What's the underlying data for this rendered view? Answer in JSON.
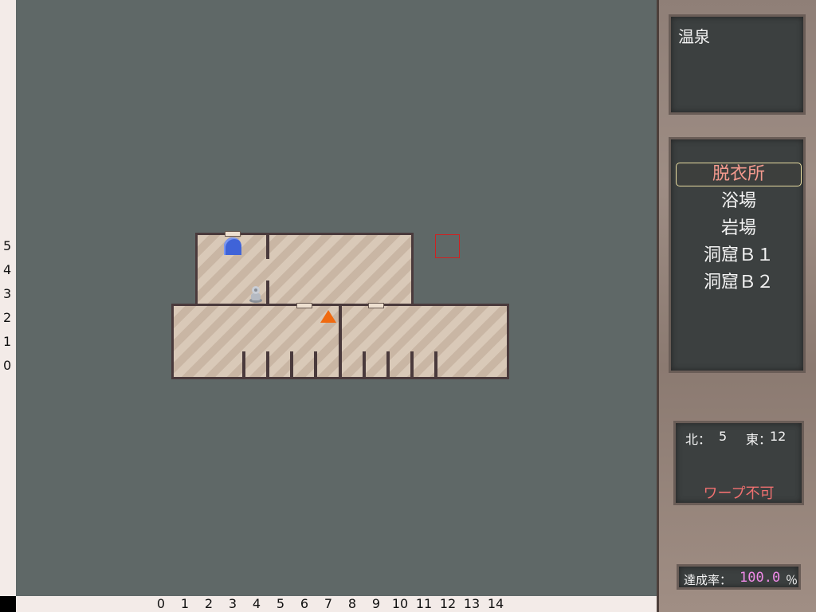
{
  "map": {
    "row_labels": [
      "5",
      "4",
      "3",
      "2",
      "1",
      "0"
    ],
    "col_labels": [
      "0",
      "1",
      "2",
      "3",
      "4",
      "5",
      "6",
      "7",
      "8",
      "9",
      "10",
      "11",
      "12",
      "13",
      "14"
    ]
  },
  "panel": {
    "area_name": "温泉",
    "floors": [
      {
        "label": "脱衣所",
        "selected": true
      },
      {
        "label": "浴場",
        "selected": false
      },
      {
        "label": "岩場",
        "selected": false
      },
      {
        "label": "洞窟Ｂ１",
        "selected": false
      },
      {
        "label": "洞窟Ｂ２",
        "selected": false
      }
    ],
    "coords": {
      "north_label": "北：",
      "north_value": "5",
      "east_label": "東：",
      "east_value": "12"
    },
    "warp_status": "ワープ不可",
    "completion": {
      "label": "達成率：",
      "value": "100.0",
      "unit": "％"
    }
  },
  "colors": {
    "map_background": "#5f6867",
    "player_marker": "#f06a10",
    "warp_text": "#f07070",
    "completion_value": "#f08ae8"
  },
  "icons": {
    "player": "orange-triangle-icon",
    "stairs": "blue-arch-door-icon",
    "statue": "stone-statue-icon",
    "target": "red-square-cursor"
  }
}
